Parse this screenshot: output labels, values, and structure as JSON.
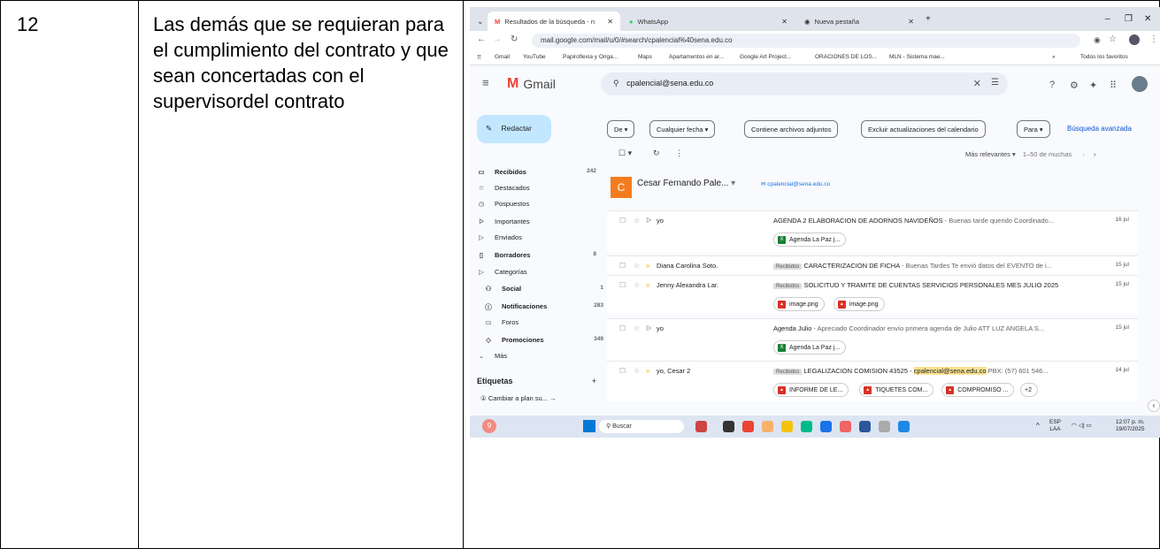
{
  "document": {
    "row_number": "12",
    "description": "Las demás que se requieran para el cumplimiento del contrato y que sean concertadas con el supervisordel contrato"
  },
  "browser": {
    "tabs": [
      {
        "label": "Resultados de la búsqueda - n",
        "active": true
      },
      {
        "label": "WhatsApp",
        "active": false
      },
      {
        "label": "Nueva pestaña",
        "active": false
      }
    ],
    "new_tab": "+",
    "url": "mail.google.com/mail/u/0/#search/cpalencial%40sena.edu.co",
    "bookmarks": [
      "Gmail",
      "YouTube",
      "Papiroflexia y Origa...",
      "Maps",
      "Apartamentos en ar...",
      "Google Art Project...",
      "ORACIONES DE LOS...",
      "MLN - Sistema mae..."
    ],
    "bookmarks_more": "»",
    "all_bookmarks": "Todos los favoritos"
  },
  "gmail": {
    "logo": "Gmail",
    "search_query": "cpalencial@sena.edu.co",
    "compose": "Redactar",
    "nav": [
      {
        "label": "Recibidos",
        "count": "242",
        "bold": true,
        "icon": "▭"
      },
      {
        "label": "Destacados",
        "count": "",
        "bold": false,
        "icon": "☆"
      },
      {
        "label": "Pospuestos",
        "count": "",
        "bold": false,
        "icon": "◷"
      },
      {
        "label": "Importantes",
        "count": "",
        "bold": false,
        "icon": "ᐅ"
      },
      {
        "label": "Enviados",
        "count": "",
        "bold": false,
        "icon": "▷"
      },
      {
        "label": "Borradores",
        "count": "8",
        "bold": true,
        "icon": "▯"
      },
      {
        "label": "Categorías",
        "count": "",
        "bold": false,
        "icon": "▷"
      },
      {
        "label": "Social",
        "count": "1",
        "bold": true,
        "icon": "⚇"
      },
      {
        "label": "Notificaciones",
        "count": "283",
        "bold": true,
        "icon": "ⓘ"
      },
      {
        "label": "Foros",
        "count": "",
        "bold": false,
        "icon": "▭"
      },
      {
        "label": "Promociones",
        "count": "349",
        "bold": true,
        "icon": "◇"
      },
      {
        "label": "Más",
        "count": "",
        "bold": false,
        "icon": "⌄"
      }
    ],
    "labels_heading": "Etiquetas",
    "labels_add": "+",
    "upgrade": "Cambiar a plan su...",
    "filters": [
      "De ▾",
      "Cualquier fecha ▾",
      "Contiene archivos adjuntos",
      "Excluir actualizaciones del calendario",
      "Para ▾"
    ],
    "advanced_search": "Búsqueda avanzada",
    "sort": "Más relevantes ▾",
    "range": "1–50 de muchas",
    "contact": {
      "initial": "C",
      "name": "Cesar Fernando Pale...",
      "email": "cpalencial@sena.edu.co"
    },
    "emails": [
      {
        "from": "yo",
        "label": "",
        "subject": "AGENDA 2 ELABORACION DE ADORNOS NAVIDEÑOS",
        "snippet": " - Buenas tarde querido Coordinado...",
        "date": "16 jul",
        "important": false,
        "attachments": [
          {
            "name": "Agenda La Paz j...",
            "type": "x"
          }
        ]
      },
      {
        "from": "Diana Carolina Soto.",
        "label": "Recibidos",
        "subject": "CARACTERIZACION DE FICHA",
        "snippet": " - Buenas Tardes Te envió datos del EVENTO de i...",
        "date": "15 jul",
        "important": true,
        "attachments": []
      },
      {
        "from": "Jenny Alexandra Lar.",
        "label": "Recibidos",
        "subject": "SOLICITUD Y TRAMITE DE CUENTAS SERVICIOS PERSONALES MES JULIO 2025",
        "snippet": "",
        "date": "15 jul",
        "important": true,
        "attachments": [
          {
            "name": "image.png",
            "type": "p"
          },
          {
            "name": "image.png",
            "type": "p"
          }
        ]
      },
      {
        "from": "yo",
        "label": "",
        "subject": "Agenda Julio",
        "snippet": " - Apreciado Coordinador envío primera agenda de Julio ATT LUZ ANGELA S...",
        "date": "15 jul",
        "important": false,
        "attachments": [
          {
            "name": "Agenda La Paz j...",
            "type": "x"
          }
        ]
      },
      {
        "from": "yo, Cesar 2",
        "label": "Recibidos",
        "subject": "LEGALIZACION COMISION 43525 - ",
        "highlight": "cpalencial@sena.edu.co",
        "snippet": " PBX: (57) 601 546...",
        "date": "14 jul",
        "important": true,
        "attachments": [
          {
            "name": "INFORME DE LE...",
            "type": "p"
          },
          {
            "name": "TIQUETES COM...",
            "type": "p"
          },
          {
            "name": "COMPROMISO ...",
            "type": "p"
          },
          {
            "name": "+2",
            "type": ""
          }
        ]
      }
    ]
  },
  "taskbar": {
    "search": "Buscar",
    "lang": "ESP",
    "lang2": "LAA",
    "time": "12:07 p. m.",
    "date": "19/07/2025"
  }
}
